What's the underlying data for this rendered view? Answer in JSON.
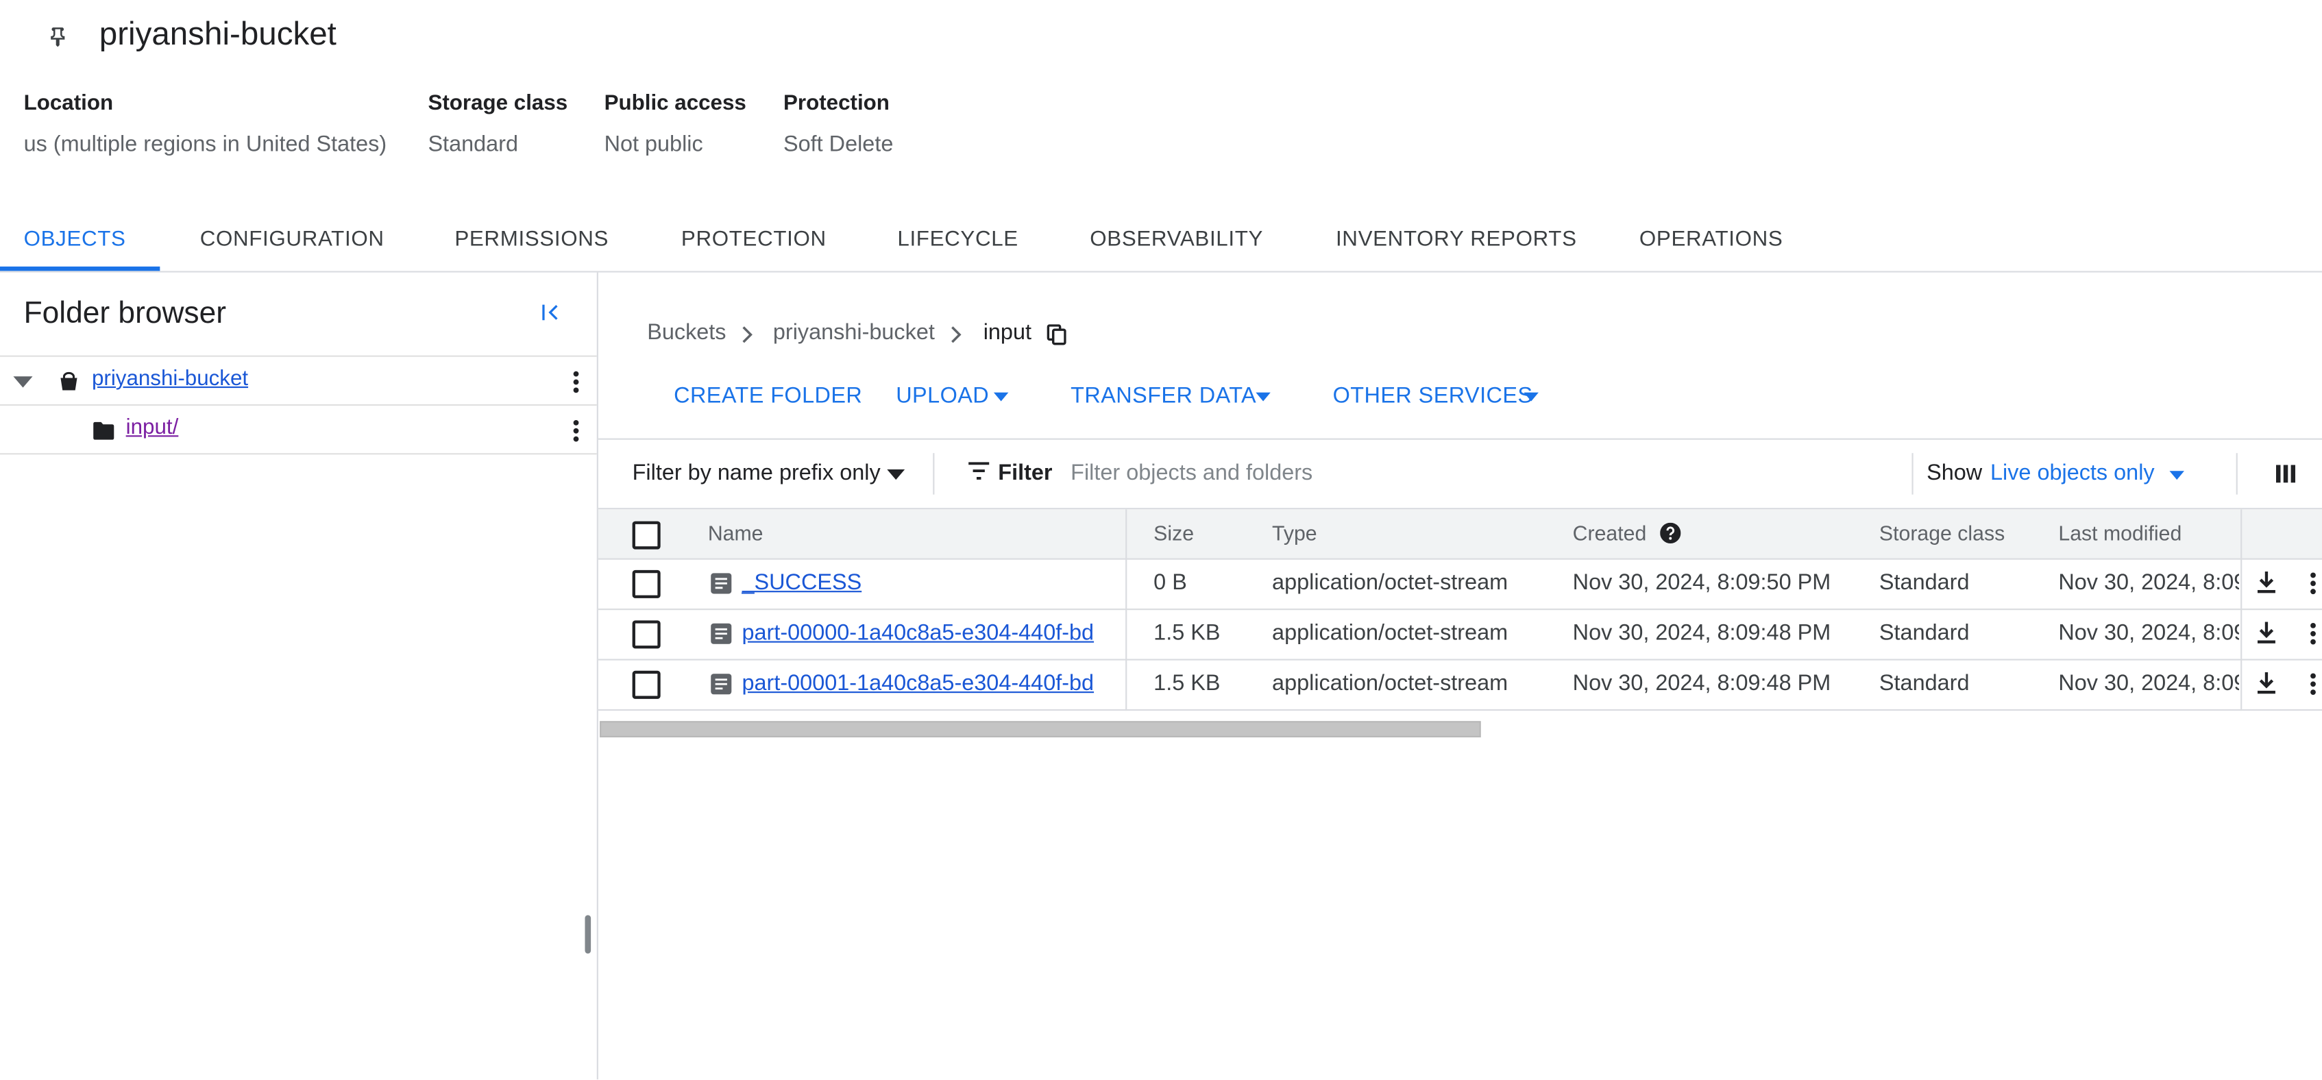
{
  "bucket": {
    "name": "priyanshi-bucket",
    "properties": [
      {
        "label": "Location",
        "value": "us (multiple regions in United States)"
      },
      {
        "label": "Storage class",
        "value": "Standard"
      },
      {
        "label": "Public access",
        "value": "Not public"
      },
      {
        "label": "Protection",
        "value": "Soft Delete"
      }
    ]
  },
  "tabs": [
    {
      "label": "OBJECTS",
      "active": true
    },
    {
      "label": "CONFIGURATION"
    },
    {
      "label": "PERMISSIONS"
    },
    {
      "label": "PROTECTION"
    },
    {
      "label": "LIFECYCLE"
    },
    {
      "label": "OBSERVABILITY"
    },
    {
      "label": "INVENTORY REPORTS"
    },
    {
      "label": "OPERATIONS"
    }
  ],
  "folder_browser": {
    "title": "Folder browser",
    "tree": [
      {
        "label": "priyanshi-bucket",
        "icon": "bucket-icon",
        "expanded": true
      },
      {
        "label": "input/",
        "icon": "folder-icon"
      }
    ]
  },
  "breadcrumb": [
    "Buckets",
    "priyanshi-bucket",
    "input"
  ],
  "actions": [
    {
      "label": "CREATE FOLDER"
    },
    {
      "label": "UPLOAD"
    },
    {
      "label": "TRANSFER DATA"
    },
    {
      "label": "OTHER SERVICES"
    }
  ],
  "filter": {
    "mode": "Filter by name prefix only",
    "label": "Filter",
    "placeholder": "Filter objects and folders",
    "show_label": "Show",
    "show_value": "Live objects only"
  },
  "table": {
    "columns": [
      "Name",
      "Size",
      "Type",
      "Created",
      "Storage class",
      "Last modified"
    ],
    "rows": [
      {
        "name": "_SUCCESS",
        "size": "0 B",
        "type": "application/octet-stream",
        "created": "Nov 30, 2024, 8:09:50 PM",
        "storage_class": "Standard",
        "last_modified": "Nov 30, 2024, 8:09"
      },
      {
        "name": "part-00000-1a40c8a5-e304-440f-bd",
        "size": "1.5 KB",
        "type": "application/octet-stream",
        "created": "Nov 30, 2024, 8:09:48 PM",
        "storage_class": "Standard",
        "last_modified": "Nov 30, 2024, 8:09"
      },
      {
        "name": "part-00001-1a40c8a5-e304-440f-bd",
        "size": "1.5 KB",
        "type": "application/octet-stream",
        "created": "Nov 30, 2024, 8:09:48 PM",
        "storage_class": "Standard",
        "last_modified": "Nov 30, 2024, 8:09"
      }
    ]
  },
  "colors": {
    "accent": "#1a73e8",
    "link": "#1a57d6",
    "visited": "#7b1fa2",
    "header_bg": "#f1f3f4"
  }
}
